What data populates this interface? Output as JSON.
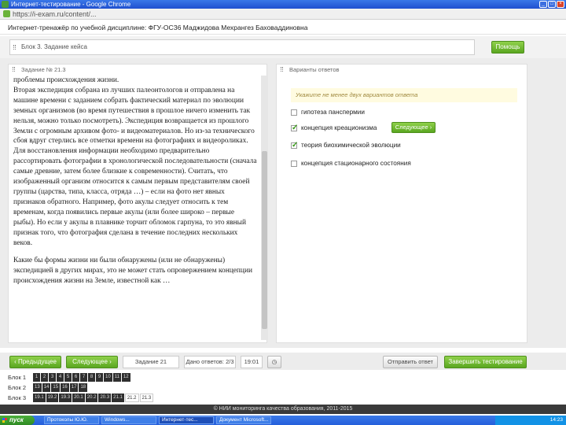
{
  "window": {
    "title": "Интернет-тестирование - Google Chrome"
  },
  "address": {
    "url": "https://i-exam.ru/content/..."
  },
  "header": {
    "test_info": "Интернет-тренажёр по учебной дисциплине: ФГУ-ОСЗ6 Маджидова Мехрангез Баховаддиновна"
  },
  "block": {
    "label": "Блок 3. Задание кейса",
    "help_label": "Помощь"
  },
  "left": {
    "title": "Задание № 21.3",
    "paragraphs": [
      "проблемы происхождения жизни.",
      "Вторая экспедиция собрана из лучших палеонтологов и отправлена на машине времени с заданием собрать фактический материал по эволюции земных организмов (во время путешествия в прошлое ничего изменить так нельзя, можно только посмотреть). Экспедиция возвращается из прошлого Земли с огромным архивом фото- и видеоматериалов. Но из-за технического сбоя вдруг стерлись все отметки времени на фотографиях и видеороликах. Для восстановления информации необходимо предварительно рассортировать фотографии в хронологической последовательности (сначала самые древние, затем более близкие к современности). Считать, что изображенный организм относится к самым первым представителям своей группы (царства, типа, класса, отряда …) – если на фото нет явных признаков обратного. Например, фото акулы следует относить к тем временам, когда появились первые акулы (или более широко – первые рыбы). Но если у акулы в плавнике торчит обломок гарпуна, то это явный признак того, что фотография сделана в течение последних нескольких веков.",
      "Какие бы формы жизни ни были обнаружены (или не обнаружены) экспедицией в других мирах, это не может стать опровержением концепции происхождения жизни на Земле, известной как …"
    ]
  },
  "right": {
    "title": "Варианты ответов",
    "hint": "Укажите не менее двух вариантов ответа",
    "options": [
      {
        "label": "гипотеза панспермии",
        "checked": false
      },
      {
        "label": "концепция креационизма",
        "checked": true
      },
      {
        "label": "теория биохимической эволюции",
        "checked": true
      },
      {
        "label": "концепция стационарного состояния",
        "checked": false
      }
    ],
    "followup_label": "Следующее"
  },
  "nav": {
    "prev": "Предыдущее",
    "next": "Следующее",
    "task_counter": "Задание 21",
    "answered": "Дано ответов: 2/3",
    "timer": "19:01",
    "send": "Отправить ответ",
    "finish": "Завершить тестирование"
  },
  "blocks": [
    {
      "label": "Блок 1",
      "cells": [
        "1",
        "2",
        "3",
        "4",
        "5",
        "6",
        "7",
        "8",
        "9",
        "10",
        "11",
        "12"
      ]
    },
    {
      "label": "Блок 2",
      "cells": [
        "13",
        "14",
        "15",
        "16",
        "17",
        "18"
      ]
    },
    {
      "label": "Блок 3",
      "cells": [
        "19.1",
        "19.2",
        "19.3",
        "20.1",
        "20.2",
        "20.3",
        "21.1",
        "21.2",
        "21.3"
      ]
    }
  ],
  "footer": {
    "text": "© НИИ мониторинга качества образования, 2011-2015"
  },
  "taskbar": {
    "start": "пуск",
    "tasks": [
      "Протоколы Ю.Ю.",
      "Windows...",
      "Интернет-тес...",
      "Документ Microsoft..."
    ],
    "clock": "14:23"
  }
}
